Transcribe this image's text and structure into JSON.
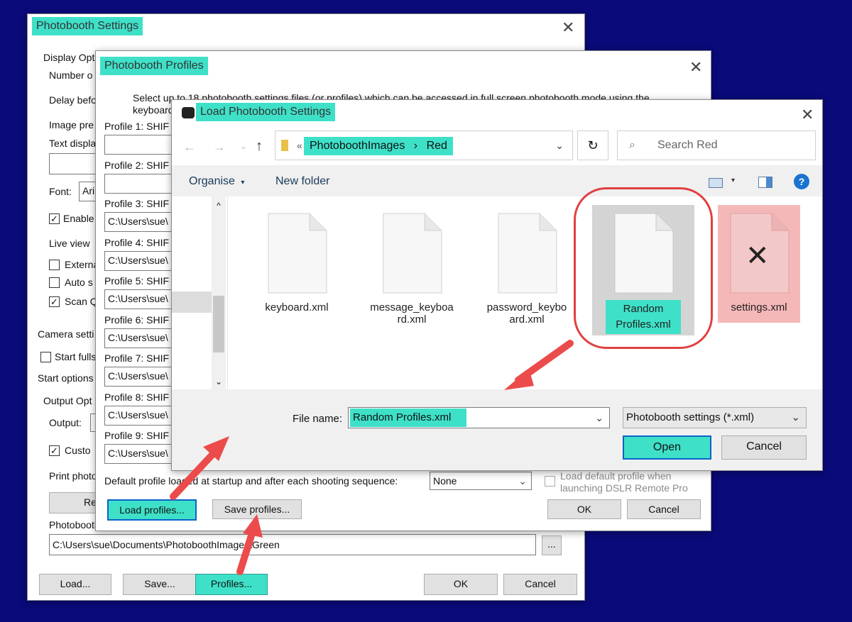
{
  "settings": {
    "title": "Photobooth Settings",
    "labels": {
      "display_options": "Display Opt",
      "number_of": "Number o",
      "delay_before": "Delay befo",
      "image_preview": "Image pre",
      "text_display": "Text displa",
      "font": "Font:",
      "font_value": "Ari",
      "enable": "Enable",
      "live_view": "Live view",
      "external": "Externa",
      "auto": "Auto s",
      "scan": "Scan Q",
      "camera_settings": "Camera setti",
      "start_fullscreen": "Start fulls",
      "start_options": "Start options",
      "output_options": "Output Opt",
      "output": "Output:",
      "custom": "Custo",
      "print_photos": "Print photo",
      "re_button": "Re",
      "photobooth_folder": "Photobooth"
    },
    "folder_path": "C:\\Users\\sue\\Documents\\PhotoboothImages\\Green",
    "browse_label": "...",
    "buttons": {
      "load": "Load...",
      "save": "Save...",
      "profiles": "Profiles...",
      "ok": "OK",
      "cancel": "Cancel"
    }
  },
  "profiles": {
    "title": "Photobooth Profiles",
    "intro": "Select up to 18 photobooth settings files (or profiles) which can be accessed in full screen photobooth mode using the keyboard",
    "rows": [
      {
        "label": "Profile 1: SHIF",
        "value": ""
      },
      {
        "label": "Profile 2: SHIF",
        "value": ""
      },
      {
        "label": "Profile 3: SHIF",
        "value": "C:\\Users\\sue\\"
      },
      {
        "label": "Profile 4: SHIF",
        "value": "C:\\Users\\sue\\"
      },
      {
        "label": "Profile 5: SHIF",
        "value": "C:\\Users\\sue\\"
      },
      {
        "label": "Profile 6: SHIF",
        "value": "C:\\Users\\sue\\"
      },
      {
        "label": "Profile 7: SHIF",
        "value": "C:\\Users\\sue\\"
      },
      {
        "label": "Profile 8: SHIF",
        "value": "C:\\Users\\sue\\"
      },
      {
        "label": "Profile 9: SHIF",
        "value": "C:\\Users\\sue\\"
      }
    ],
    "default_label": "Default profile loaded at startup and after each shooting sequence:",
    "default_value": "None",
    "load_default_line1": "Load default profile when",
    "load_default_line2": "launching DSLR Remote Pro",
    "buttons": {
      "load": "Load profiles...",
      "save": "Save profiles...",
      "ok": "OK",
      "cancel": "Cancel"
    }
  },
  "dialog": {
    "title": "Load Photobooth Settings",
    "breadcrumb_prefix": "«",
    "breadcrumb": [
      "PhotoboothImages",
      "Red"
    ],
    "search_placeholder": "Search Red",
    "organise": "Organise",
    "new_folder": "New folder",
    "files": [
      {
        "line1": "keyboard.xml",
        "line2": ""
      },
      {
        "line1": "message_keyboa",
        "line2": "rd.xml"
      },
      {
        "line1": "password_keybo",
        "line2": "ard.xml"
      },
      {
        "line1": "Random",
        "line2": "Profiles.xml"
      },
      {
        "line1": "settings.xml",
        "line2": ""
      }
    ],
    "file_name_label": "File name:",
    "file_name_value": "Random Profiles.xml",
    "filter": "Photobooth settings (*.xml)",
    "open": "Open",
    "cancel": "Cancel"
  },
  "colors": {
    "highlight": "#3fe0c8",
    "arrow": "#ec4b4b",
    "background": "#0a0a7a",
    "rejected": "#f5b8b8"
  }
}
